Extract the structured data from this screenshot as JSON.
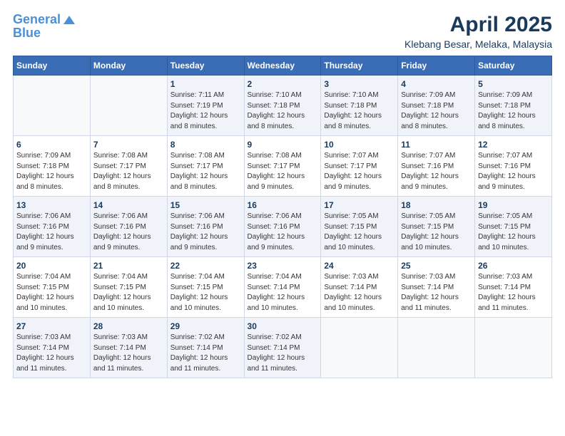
{
  "logo": {
    "line1": "General",
    "line2": "Blue"
  },
  "title": "April 2025",
  "subtitle": "Klebang Besar, Melaka, Malaysia",
  "header_days": [
    "Sunday",
    "Monday",
    "Tuesday",
    "Wednesday",
    "Thursday",
    "Friday",
    "Saturday"
  ],
  "weeks": [
    [
      {
        "num": "",
        "info": ""
      },
      {
        "num": "",
        "info": ""
      },
      {
        "num": "1",
        "info": "Sunrise: 7:11 AM\nSunset: 7:19 PM\nDaylight: 12 hours\nand 8 minutes."
      },
      {
        "num": "2",
        "info": "Sunrise: 7:10 AM\nSunset: 7:18 PM\nDaylight: 12 hours\nand 8 minutes."
      },
      {
        "num": "3",
        "info": "Sunrise: 7:10 AM\nSunset: 7:18 PM\nDaylight: 12 hours\nand 8 minutes."
      },
      {
        "num": "4",
        "info": "Sunrise: 7:09 AM\nSunset: 7:18 PM\nDaylight: 12 hours\nand 8 minutes."
      },
      {
        "num": "5",
        "info": "Sunrise: 7:09 AM\nSunset: 7:18 PM\nDaylight: 12 hours\nand 8 minutes."
      }
    ],
    [
      {
        "num": "6",
        "info": "Sunrise: 7:09 AM\nSunset: 7:18 PM\nDaylight: 12 hours\nand 8 minutes."
      },
      {
        "num": "7",
        "info": "Sunrise: 7:08 AM\nSunset: 7:17 PM\nDaylight: 12 hours\nand 8 minutes."
      },
      {
        "num": "8",
        "info": "Sunrise: 7:08 AM\nSunset: 7:17 PM\nDaylight: 12 hours\nand 8 minutes."
      },
      {
        "num": "9",
        "info": "Sunrise: 7:08 AM\nSunset: 7:17 PM\nDaylight: 12 hours\nand 9 minutes."
      },
      {
        "num": "10",
        "info": "Sunrise: 7:07 AM\nSunset: 7:17 PM\nDaylight: 12 hours\nand 9 minutes."
      },
      {
        "num": "11",
        "info": "Sunrise: 7:07 AM\nSunset: 7:16 PM\nDaylight: 12 hours\nand 9 minutes."
      },
      {
        "num": "12",
        "info": "Sunrise: 7:07 AM\nSunset: 7:16 PM\nDaylight: 12 hours\nand 9 minutes."
      }
    ],
    [
      {
        "num": "13",
        "info": "Sunrise: 7:06 AM\nSunset: 7:16 PM\nDaylight: 12 hours\nand 9 minutes."
      },
      {
        "num": "14",
        "info": "Sunrise: 7:06 AM\nSunset: 7:16 PM\nDaylight: 12 hours\nand 9 minutes."
      },
      {
        "num": "15",
        "info": "Sunrise: 7:06 AM\nSunset: 7:16 PM\nDaylight: 12 hours\nand 9 minutes."
      },
      {
        "num": "16",
        "info": "Sunrise: 7:06 AM\nSunset: 7:16 PM\nDaylight: 12 hours\nand 9 minutes."
      },
      {
        "num": "17",
        "info": "Sunrise: 7:05 AM\nSunset: 7:15 PM\nDaylight: 12 hours\nand 10 minutes."
      },
      {
        "num": "18",
        "info": "Sunrise: 7:05 AM\nSunset: 7:15 PM\nDaylight: 12 hours\nand 10 minutes."
      },
      {
        "num": "19",
        "info": "Sunrise: 7:05 AM\nSunset: 7:15 PM\nDaylight: 12 hours\nand 10 minutes."
      }
    ],
    [
      {
        "num": "20",
        "info": "Sunrise: 7:04 AM\nSunset: 7:15 PM\nDaylight: 12 hours\nand 10 minutes."
      },
      {
        "num": "21",
        "info": "Sunrise: 7:04 AM\nSunset: 7:15 PM\nDaylight: 12 hours\nand 10 minutes."
      },
      {
        "num": "22",
        "info": "Sunrise: 7:04 AM\nSunset: 7:15 PM\nDaylight: 12 hours\nand 10 minutes."
      },
      {
        "num": "23",
        "info": "Sunrise: 7:04 AM\nSunset: 7:14 PM\nDaylight: 12 hours\nand 10 minutes."
      },
      {
        "num": "24",
        "info": "Sunrise: 7:03 AM\nSunset: 7:14 PM\nDaylight: 12 hours\nand 10 minutes."
      },
      {
        "num": "25",
        "info": "Sunrise: 7:03 AM\nSunset: 7:14 PM\nDaylight: 12 hours\nand 11 minutes."
      },
      {
        "num": "26",
        "info": "Sunrise: 7:03 AM\nSunset: 7:14 PM\nDaylight: 12 hours\nand 11 minutes."
      }
    ],
    [
      {
        "num": "27",
        "info": "Sunrise: 7:03 AM\nSunset: 7:14 PM\nDaylight: 12 hours\nand 11 minutes."
      },
      {
        "num": "28",
        "info": "Sunrise: 7:03 AM\nSunset: 7:14 PM\nDaylight: 12 hours\nand 11 minutes."
      },
      {
        "num": "29",
        "info": "Sunrise: 7:02 AM\nSunset: 7:14 PM\nDaylight: 12 hours\nand 11 minutes."
      },
      {
        "num": "30",
        "info": "Sunrise: 7:02 AM\nSunset: 7:14 PM\nDaylight: 12 hours\nand 11 minutes."
      },
      {
        "num": "",
        "info": ""
      },
      {
        "num": "",
        "info": ""
      },
      {
        "num": "",
        "info": ""
      }
    ]
  ]
}
